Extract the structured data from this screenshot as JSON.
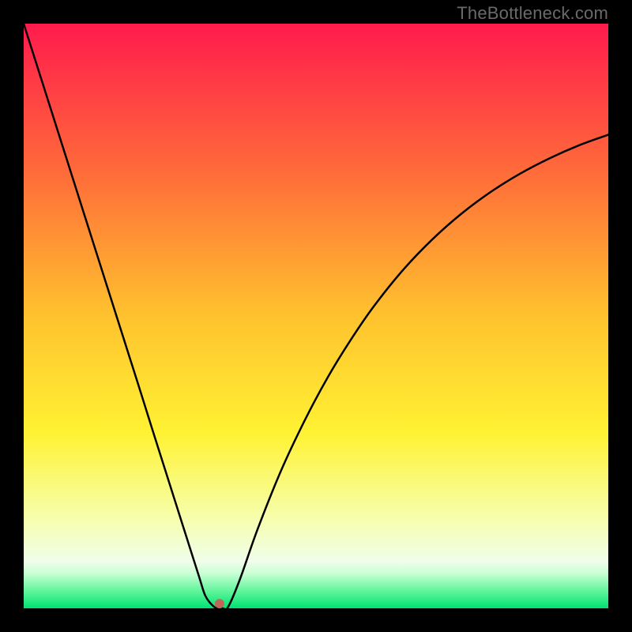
{
  "watermark": "TheBottleneck.com",
  "chart_data": {
    "type": "line",
    "title": "",
    "xlabel": "",
    "ylabel": "",
    "xlim": [
      0,
      100
    ],
    "ylim": [
      0,
      100
    ],
    "grid": false,
    "background_gradient": {
      "stops": [
        {
          "offset": 0.0,
          "color": "#ff1b4d"
        },
        {
          "offset": 0.25,
          "color": "#ff6a3a"
        },
        {
          "offset": 0.5,
          "color": "#ffc22e"
        },
        {
          "offset": 0.7,
          "color": "#fff233"
        },
        {
          "offset": 0.85,
          "color": "#f6ffb0"
        },
        {
          "offset": 0.92,
          "color": "#effdea"
        },
        {
          "offset": 0.94,
          "color": "#caffd4"
        },
        {
          "offset": 0.97,
          "color": "#62f59c"
        },
        {
          "offset": 1.0,
          "color": "#00e371"
        }
      ]
    },
    "series": [
      {
        "name": "bottleneck-curve",
        "type": "line",
        "color": "#000000",
        "x": [
          0,
          2,
          4,
          6,
          8,
          10,
          12,
          14,
          16,
          18,
          20,
          22,
          24,
          26,
          28,
          30,
          31,
          32,
          33,
          34,
          35,
          37,
          40,
          44,
          48,
          52,
          56,
          60,
          65,
          70,
          75,
          80,
          85,
          90,
          95,
          100
        ],
        "y": [
          100,
          93.7,
          87.4,
          81.1,
          74.8,
          68.5,
          62.2,
          55.9,
          49.6,
          43.3,
          37.0,
          30.6,
          24.3,
          18.0,
          11.7,
          5.4,
          2.3,
          0.8,
          0.0,
          0.0,
          0.3,
          5.0,
          13.5,
          23.5,
          32.0,
          39.5,
          46.0,
          51.8,
          58.0,
          63.2,
          67.6,
          71.3,
          74.4,
          77.0,
          79.2,
          81.0
        ]
      }
    ],
    "marker": {
      "name": "optimum-point",
      "x": 33.5,
      "y": 0.8,
      "color": "#c06858",
      "radius": 6
    }
  }
}
